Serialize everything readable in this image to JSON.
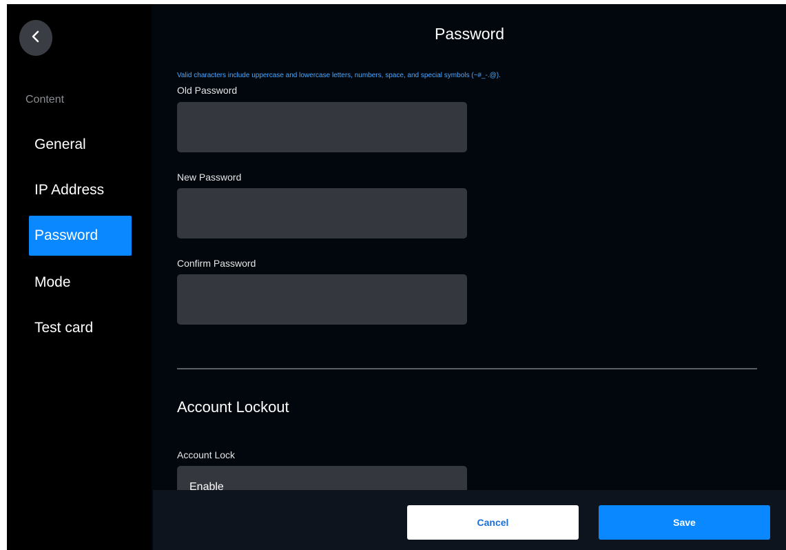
{
  "sidebar": {
    "back_icon": "chevron-left-icon",
    "section_label": "Content",
    "items": [
      {
        "label": "General",
        "active": false
      },
      {
        "label": "IP Address",
        "active": false
      },
      {
        "label": "Password",
        "active": true
      },
      {
        "label": "Mode",
        "active": false
      },
      {
        "label": "Test card",
        "active": false
      }
    ]
  },
  "main": {
    "title": "Password",
    "hint": "Valid characters include uppercase and lowercase letters, numbers, space, and special symbols (~#_-.@).",
    "fields": {
      "old_password": {
        "label": "Old Password",
        "value": ""
      },
      "new_password": {
        "label": "New Password",
        "value": ""
      },
      "confirm_password": {
        "label": "Confirm Password",
        "value": ""
      }
    },
    "lockout": {
      "section_title": "Account Lockout",
      "account_lock_label": "Account Lock",
      "account_lock_value": "Enable"
    }
  },
  "footer": {
    "cancel_label": "Cancel",
    "save_label": "Save"
  },
  "colors": {
    "accent": "#0a88ff",
    "background": "#02070d",
    "input_bg": "#34373d",
    "hint_text": "#4aa8ff"
  }
}
